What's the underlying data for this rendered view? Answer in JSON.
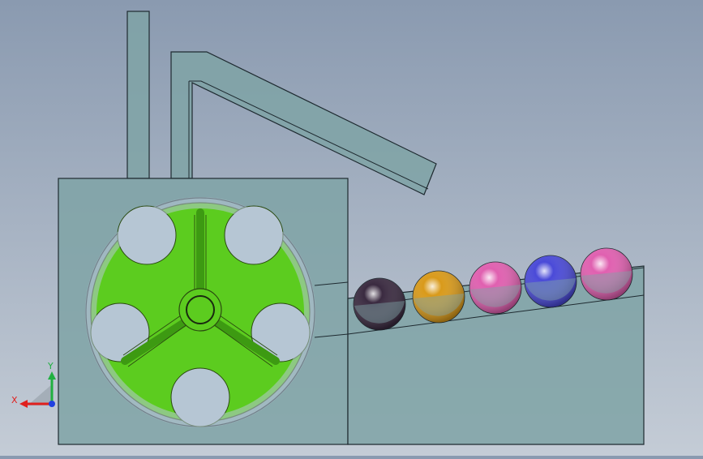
{
  "scene": {
    "background_top": "#8a9ab0",
    "background_bottom": "#c4ccd6",
    "housing_fill": "#7fa3a6",
    "wheel_fill": "#5ccc1f",
    "wheel_dark": "#3d9a12",
    "outline": "#1e2a30"
  },
  "balls": [
    {
      "color": "#3a2a40",
      "label": "black-ball"
    },
    {
      "color": "#d99a1a",
      "label": "orange-ball"
    },
    {
      "color": "#e060b0",
      "label": "pink-ball"
    },
    {
      "color": "#4a4ad8",
      "label": "blue-ball"
    },
    {
      "color": "#e060b0",
      "label": "pink-ball"
    }
  ],
  "triad": {
    "x_label": "X",
    "y_label": "Y",
    "x_color": "#e0201e",
    "y_color": "#20b040",
    "z_color": "#2040e0"
  }
}
